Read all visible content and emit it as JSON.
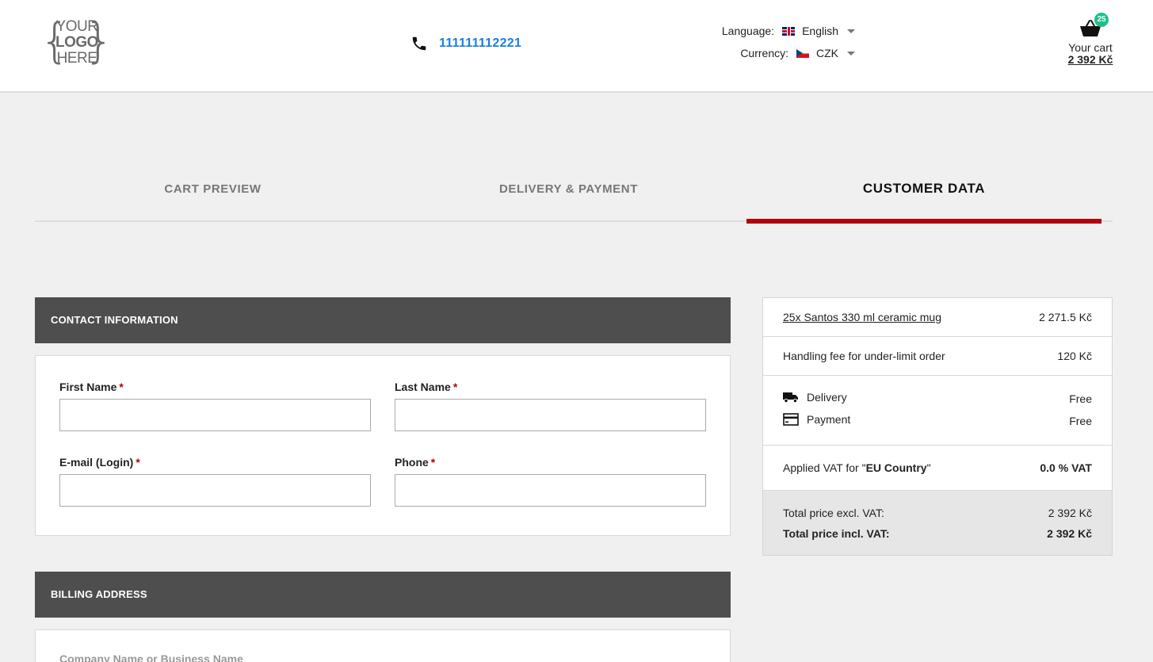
{
  "header": {
    "logo": {
      "line1": "YOUR",
      "line2": "LOGO",
      "line3": "HERE"
    },
    "phone": "111111112221",
    "language": {
      "label": "Language:",
      "value": "English"
    },
    "currency": {
      "label": "Currency:",
      "value": "CZK"
    },
    "cart": {
      "count": "25",
      "label": "Your cart",
      "amount": "2 392 Kč"
    }
  },
  "steps": [
    {
      "label": "Cart preview"
    },
    {
      "label": "Delivery & payment"
    },
    {
      "label": "Customer data"
    }
  ],
  "contact": {
    "title": "Contact information",
    "fields": [
      {
        "label": "First Name",
        "required": "*",
        "value": ""
      },
      {
        "label": "Last Name",
        "required": "*",
        "value": ""
      },
      {
        "label": "E-mail (Login)",
        "required": "*",
        "value": ""
      },
      {
        "label": "Phone",
        "required": "*",
        "value": ""
      }
    ]
  },
  "billing": {
    "title": "Billing address",
    "company_label": "Company Name or Business Name"
  },
  "summary": {
    "item": {
      "label": "25x Santos 330 ml ceramic mug",
      "price": "2 271.5 Kč"
    },
    "handling": {
      "label": "Handling fee for under-limit order",
      "price": "120 Kč"
    },
    "delivery": {
      "label": "Delivery",
      "price": "Free"
    },
    "payment": {
      "label": "Payment",
      "price": "Free"
    },
    "vat": {
      "prefix": "Applied VAT for \"",
      "country": "EU Country",
      "suffix": "\"",
      "value": "0.0 % VAT"
    },
    "total_excl": {
      "label": "Total price excl. VAT:",
      "value": "2 392 Kč"
    },
    "total_incl": {
      "label": "Total price incl. VAT:",
      "value": "2 392 Kč"
    }
  },
  "colors": {
    "accent": "#b3000b",
    "link": "#1a7fe0",
    "badge": "#1ec08a",
    "section_header": "#4e4e4e"
  }
}
